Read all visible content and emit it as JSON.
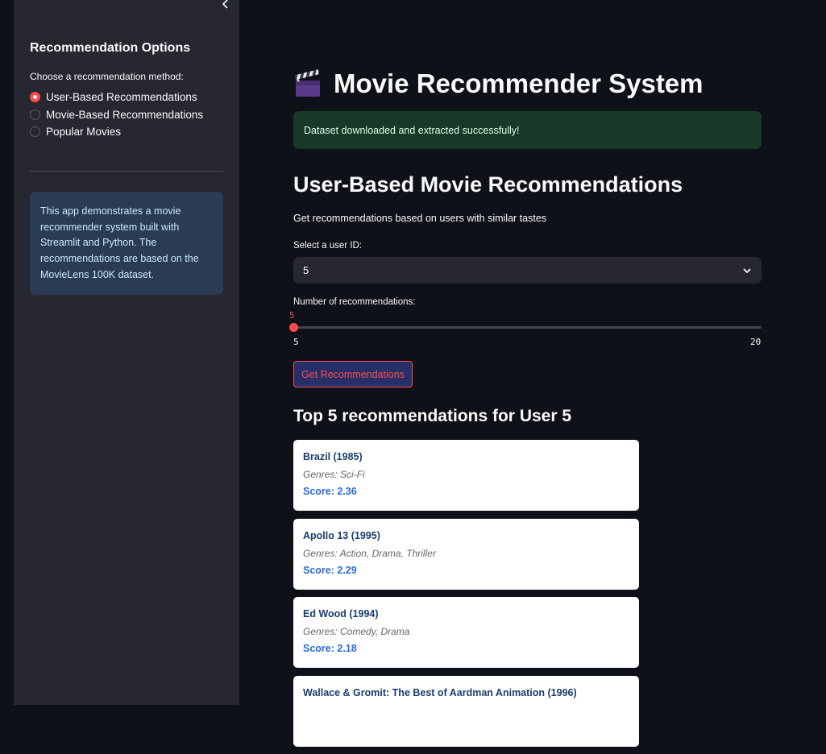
{
  "sidebar": {
    "title": "Recommendation Options",
    "method_label": "Choose a recommendation method:",
    "methods": [
      {
        "label": "User-Based Recommendations",
        "selected": true
      },
      {
        "label": "Movie-Based Recommendations",
        "selected": false
      },
      {
        "label": "Popular Movies",
        "selected": false
      }
    ],
    "info": "This app demonstrates a movie recommender system built with Streamlit and Python. The recommendations are based on the MovieLens 100K dataset."
  },
  "main": {
    "title": "Movie Recommender System",
    "title_icon": "clapper-board-icon",
    "success_message": "Dataset downloaded and extracted successfully!",
    "section_title": "User-Based Movie Recommendations",
    "section_subtitle": "Get recommendations based on users with similar tastes",
    "user_select": {
      "label": "Select a user ID:",
      "value": "5"
    },
    "num_slider": {
      "label": "Number of recommendations:",
      "value": "5",
      "min": "5",
      "max": "20"
    },
    "button_label": "Get Recommendations",
    "results_title": "Top 5 recommendations for User 5",
    "recommendations": [
      {
        "title": "Brazil (1985)",
        "genres": "Genres: Sci-Fi",
        "score": "Score: 2.36"
      },
      {
        "title": "Apollo 13 (1995)",
        "genres": "Genres: Action, Drama, Thriller",
        "score": "Score: 2.29"
      },
      {
        "title": "Ed Wood (1994)",
        "genres": "Genres: Comedy, Drama",
        "score": "Score: 2.18"
      },
      {
        "title": "Wallace & Gromit: The Best of Aardman Animation (1996)",
        "genres": "",
        "score": ""
      }
    ]
  },
  "colors": {
    "background": "#0e1117",
    "sidebar": "#262730",
    "accent": "#ff4b4b",
    "success_bg": "#173928",
    "info_bg": "#2b3a55"
  }
}
